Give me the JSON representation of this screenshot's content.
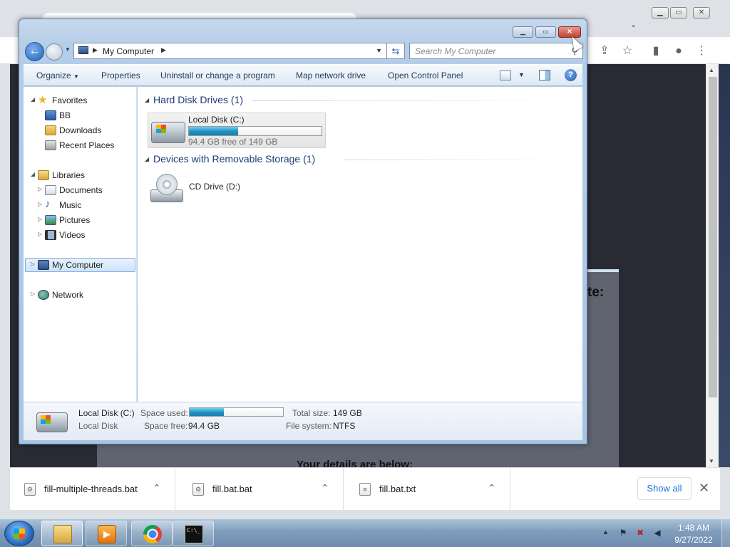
{
  "chrome": {
    "modal_heading_fragment": "te:",
    "modal_details_text": "Your details are below:"
  },
  "explorer": {
    "address": {
      "location": "My Computer"
    },
    "search": {
      "placeholder": "Search My Computer"
    },
    "commands": [
      "Organize",
      "Properties",
      "Uninstall or change a program",
      "Map network drive",
      "Open Control Panel"
    ],
    "nav": {
      "favorites": "Favorites",
      "favorites_items": [
        "BB",
        "Downloads",
        "Recent Places"
      ],
      "libraries": "Libraries",
      "libraries_items": [
        "Documents",
        "Music",
        "Pictures",
        "Videos"
      ],
      "my_computer": "My Computer",
      "network": "Network"
    },
    "groups": {
      "hard_disk": "Hard Disk Drives (1)",
      "removable": "Devices with Removable Storage (1)"
    },
    "local_disk": {
      "name": "Local Disk (C:)",
      "free_text": "94.4 GB free of 149 GB",
      "used_fraction": 0.37
    },
    "cd_drive": {
      "name": "CD Drive (D:)"
    },
    "details": {
      "title": "Local Disk (C:)",
      "subtitle": "Local Disk",
      "space_used_label": "Space used:",
      "space_free_label": "Space free:",
      "space_free_value": "94.4 GB",
      "total_size_label": "Total size:",
      "total_size_value": "149 GB",
      "file_system_label": "File system:",
      "file_system_value": "NTFS"
    }
  },
  "downloads": {
    "items": [
      "fill-multiple-threads.bat",
      "fill.bat.bat",
      "fill.bat.txt"
    ],
    "show_all": "Show all"
  },
  "taskbar": {
    "time": "1:48 AM",
    "date": "9/27/2022"
  },
  "colors": {
    "accent": "#1f8fc0",
    "explorer_frame": "#b5cde8",
    "close_button": "#c4432f"
  }
}
